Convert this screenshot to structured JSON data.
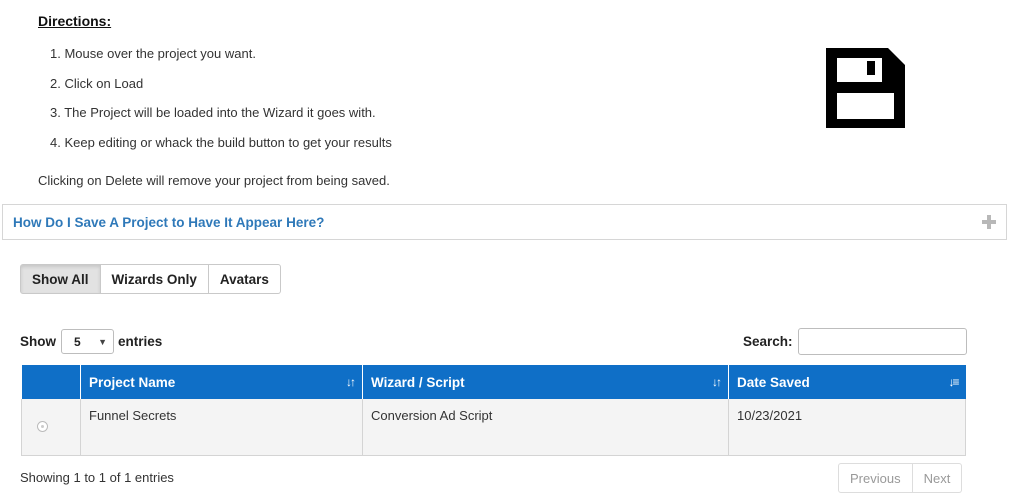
{
  "directions": {
    "title": "Directions:",
    "steps": [
      "1. Mouse over the project you want.",
      "2. Click on Load",
      "3. The Project will be loaded into the Wizard it goes with.",
      "4. Keep editing or whack the build button to get your results"
    ],
    "note": "Clicking on Delete will remove your project from being saved."
  },
  "icons": {
    "save": "floppy-disk-icon",
    "expand": "plus-icon",
    "sort": "sort-arrows-icon"
  },
  "accordion": {
    "title": "How Do I Save A Project to Have It Appear Here?"
  },
  "filters": {
    "show_all": "Show All",
    "wizards_only": "Wizards Only",
    "avatars": "Avatars"
  },
  "length": {
    "show_label": "Show",
    "value": "5",
    "entries_label": "entries"
  },
  "search": {
    "label": "Search:",
    "value": ""
  },
  "table": {
    "headers": {
      "project": "Project Name",
      "wizard": "Wizard / Script",
      "date": "Date Saved"
    },
    "rows": [
      {
        "project": "Funnel Secrets",
        "wizard": "Conversion Ad Script",
        "date": "10/23/2021"
      }
    ]
  },
  "footer": {
    "info": "Showing 1 to 1 of 1 entries",
    "previous": "Previous",
    "next": "Next"
  },
  "colors": {
    "header_blue": "#0f6fc7",
    "link_blue": "#2f79b9"
  }
}
